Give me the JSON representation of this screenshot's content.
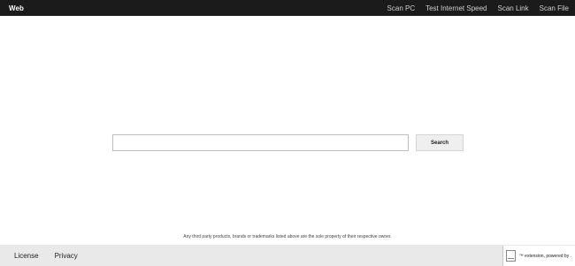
{
  "header": {
    "brand": "Web",
    "nav": [
      {
        "label": "Scan PC"
      },
      {
        "label": "Test Internet Speed"
      },
      {
        "label": "Scan Link"
      },
      {
        "label": "Scan File"
      }
    ]
  },
  "search": {
    "value": "",
    "placeholder": "",
    "button_label": "Search"
  },
  "disclaimer": "Any third party products, brands or trademarks listed above are the sole property of their respective owner.",
  "footer": {
    "links": [
      {
        "label": "License"
      },
      {
        "label": "Privacy"
      }
    ]
  },
  "extension_badge": {
    "text": "™ extension, powered by ."
  },
  "colors": {
    "topbar": "#1b1b1b",
    "footer": "#e9e9e9",
    "page": "#ffffff"
  }
}
